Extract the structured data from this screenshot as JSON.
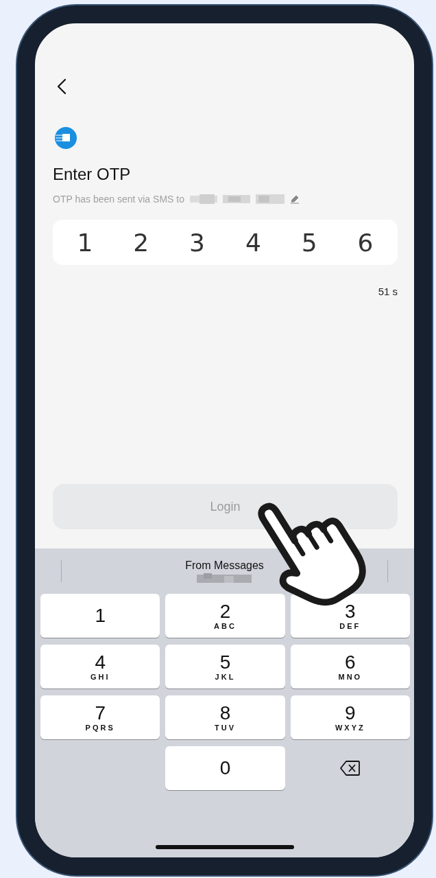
{
  "screen": {
    "title": "Enter OTP",
    "subtitle": "OTP has been sent via SMS to",
    "otp_digits": [
      "1",
      "2",
      "3",
      "4",
      "5",
      "6"
    ],
    "timer": "51 s",
    "login_button": {
      "label": "Login",
      "disabled": true
    }
  },
  "keyboard": {
    "suggestion": "From Messages",
    "rows": [
      [
        {
          "kind": "digit",
          "digit": "1"
        },
        {
          "kind": "digit",
          "digit": "2",
          "letters": "ABC"
        },
        {
          "kind": "digit",
          "digit": "3",
          "letters": "DEF"
        }
      ],
      [
        {
          "kind": "digit",
          "digit": "4",
          "letters": "GHI"
        },
        {
          "kind": "digit",
          "digit": "5",
          "letters": "JKL"
        },
        {
          "kind": "digit",
          "digit": "6",
          "letters": "MNO"
        }
      ],
      [
        {
          "kind": "digit",
          "digit": "7",
          "letters": "PQRS"
        },
        {
          "kind": "digit",
          "digit": "8",
          "letters": "TUV"
        },
        {
          "kind": "digit",
          "digit": "9",
          "letters": "WXYZ"
        }
      ],
      [
        {
          "kind": "empty"
        },
        {
          "kind": "digit",
          "digit": "0"
        },
        {
          "kind": "delete"
        }
      ]
    ]
  }
}
